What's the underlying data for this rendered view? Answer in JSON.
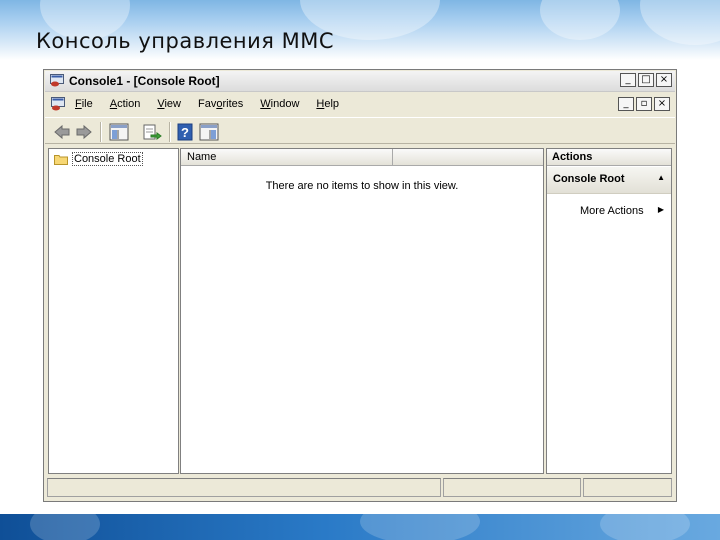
{
  "slide": {
    "title": "Консоль управления MMC"
  },
  "window": {
    "title": "Console1 - [Console Root]",
    "caption_buttons": [
      "_",
      "□",
      "×"
    ],
    "mdi_buttons": [
      "_",
      "▫",
      "×"
    ]
  },
  "menu": {
    "items": [
      {
        "u": "F",
        "rest": "ile"
      },
      {
        "u": "A",
        "rest": "ction"
      },
      {
        "u": "V",
        "rest": "iew"
      },
      {
        "pre": "Fav",
        "u": "o",
        "rest": "rites"
      },
      {
        "u": "W",
        "rest": "indow"
      },
      {
        "u": "H",
        "rest": "elp"
      }
    ]
  },
  "toolbar": {
    "icons": [
      "back-arrow-icon",
      "forward-arrow-icon",
      "show-hide-tree-icon",
      "export-list-icon",
      "help-icon",
      "show-hide-action-pane-icon"
    ]
  },
  "tree": {
    "root_label": "Console Root"
  },
  "list": {
    "columns": [
      "Name",
      ""
    ],
    "empty_message": "There are no items to show in this view."
  },
  "actions": {
    "header": "Actions",
    "section": "Console Root",
    "item": "More Actions"
  },
  "colors": {
    "slide_band": "#2a7ac7",
    "window_bg": "#ece9d8"
  }
}
